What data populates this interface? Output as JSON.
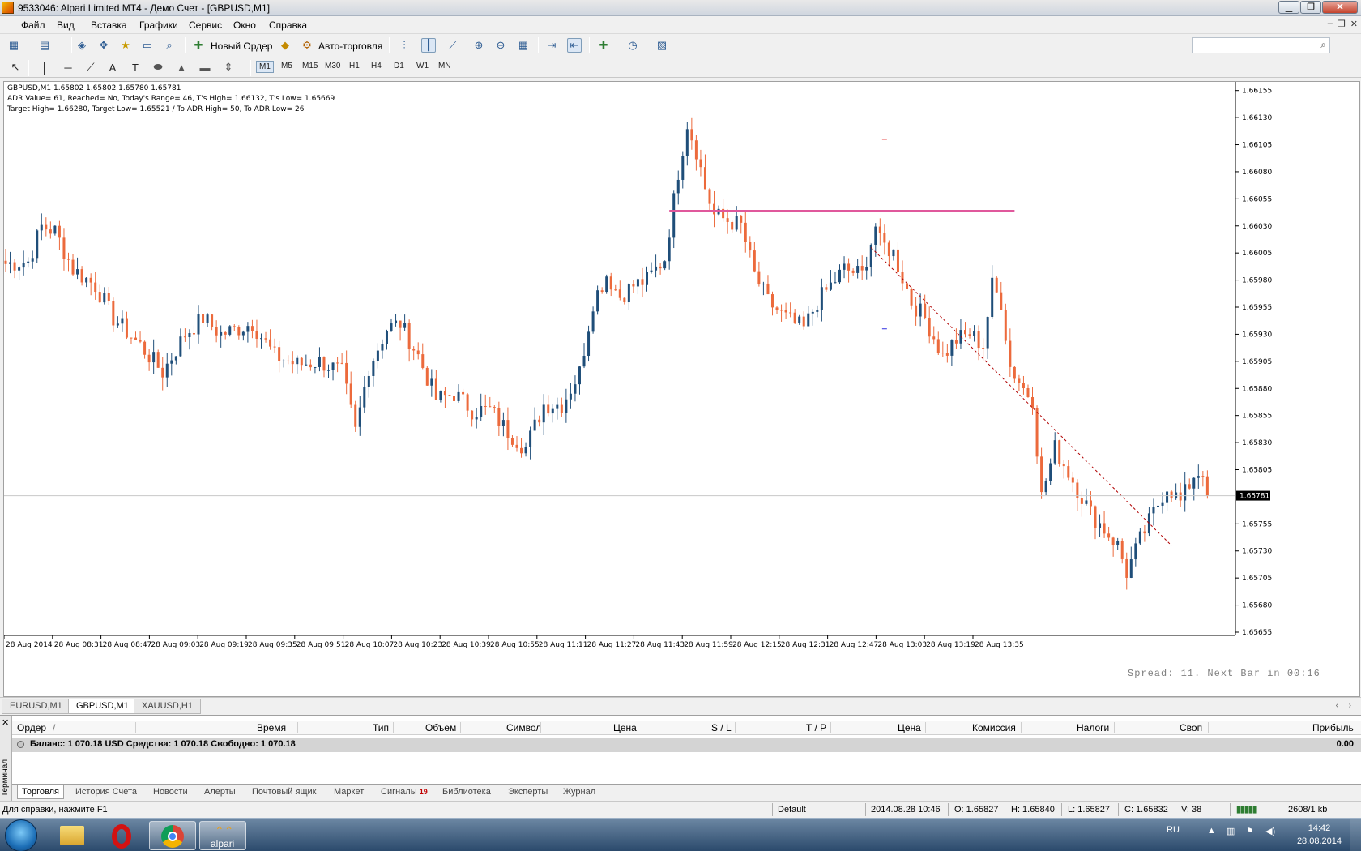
{
  "window": {
    "title": "9533046: Alpari Limited MT4 - Демо Счет - [GBPUSD,M1]"
  },
  "menu": [
    "Файл",
    "Вид",
    "Вставка",
    "Графики",
    "Сервис",
    "Окно",
    "Справка"
  ],
  "toolbar": {
    "new_order": "Новый Ордер",
    "auto_trading": "Авто-торговля"
  },
  "timeframes": [
    "M1",
    "M5",
    "M15",
    "M30",
    "H1",
    "H4",
    "D1",
    "W1",
    "MN"
  ],
  "active_timeframe": "M1",
  "chart_info": {
    "line1": "GBPUSD,M1  1.65802 1.65802 1.65780 1.65781",
    "line2": "ADR Value= 61, Reached= No, Today's Range= 46, T's High= 1.66132, T's Low= 1.65669",
    "line3": "Target High= 1.66280, Target Low= 1.65521 / To ADR High= 50, To ADR Low= 26"
  },
  "spread_text": "Spread: 11. Next Bar in 00:16",
  "chart_data": {
    "type": "candlestick",
    "symbol": "GBPUSD",
    "timeframe": "M1",
    "current_price": 1.65781,
    "y_ticks": [
      "1.66155",
      "1.66130",
      "1.66105",
      "1.66080",
      "1.66055",
      "1.66030",
      "1.66005",
      "1.65980",
      "1.65955",
      "1.65930",
      "1.65905",
      "1.65880",
      "1.65855",
      "1.65830",
      "1.65805",
      "1.65781",
      "1.65755",
      "1.65730",
      "1.65705",
      "1.65680",
      "1.65655"
    ],
    "ylim": [
      1.65652,
      1.66163
    ],
    "x_ticks": [
      "28 Aug 2014",
      "28 Aug 08:31",
      "28 Aug 08:47",
      "28 Aug 09:03",
      "28 Aug 09:19",
      "28 Aug 09:35",
      "28 Aug 09:51",
      "28 Aug 10:07",
      "28 Aug 10:23",
      "28 Aug 10:39",
      "28 Aug 10:55",
      "28 Aug 11:11",
      "28 Aug 11:27",
      "28 Aug 11:43",
      "28 Aug 11:59",
      "28 Aug 12:15",
      "28 Aug 12:31",
      "28 Aug 12:47",
      "28 Aug 13:03",
      "28 Aug 13:19",
      "28 Aug 13:35"
    ],
    "candle_count": 205,
    "close_path": [
      [
        0,
        1.65995
      ],
      [
        5,
        1.65997
      ],
      [
        8,
        1.6603
      ],
      [
        11,
        1.66025
      ],
      [
        15,
        1.6599
      ],
      [
        20,
        1.65975
      ],
      [
        24,
        1.65945
      ],
      [
        30,
        1.6592
      ],
      [
        35,
        1.65895
      ],
      [
        40,
        1.6593
      ],
      [
        44,
        1.65945
      ],
      [
        48,
        1.6593
      ],
      [
        55,
        1.6594
      ],
      [
        60,
        1.6591
      ],
      [
        65,
        1.65902
      ],
      [
        70,
        1.65905
      ],
      [
        75,
        1.65895
      ],
      [
        78,
        1.6584
      ],
      [
        81,
        1.659
      ],
      [
        85,
        1.65935
      ],
      [
        88,
        1.6594
      ],
      [
        92,
        1.6591
      ],
      [
        96,
        1.6587
      ],
      [
        100,
        1.65875
      ],
      [
        104,
        1.6586
      ],
      [
        108,
        1.6586
      ],
      [
        112,
        1.6584
      ],
      [
        116,
        1.65825
      ],
      [
        120,
        1.65865
      ],
      [
        124,
        1.65865
      ],
      [
        128,
        1.65895
      ],
      [
        131,
        1.6596
      ],
      [
        134,
        1.65985
      ],
      [
        137,
        1.65965
      ],
      [
        140,
        1.65975
      ],
      [
        143,
        1.6598
      ],
      [
        147,
        1.66
      ],
      [
        150,
        1.6608
      ],
      [
        152,
        1.66125
      ],
      [
        154,
        1.661
      ],
      [
        156,
        1.66065
      ],
      [
        158,
        1.6604
      ],
      [
        161,
        1.66035
      ],
      [
        164,
        1.6603
      ],
      [
        167,
        1.65985
      ],
      [
        170,
        1.6596
      ],
      [
        174,
        1.65945
      ],
      [
        178,
        1.65935
      ],
      [
        181,
        1.6596
      ],
      [
        184,
        1.65975
      ],
      [
        187,
        1.6599
      ],
      [
        191,
        1.65985
      ],
      [
        194,
        1.6603
      ],
      [
        195,
        1.66015
      ],
      [
        198,
        1.66005
      ],
      [
        202,
        1.6596
      ],
      [
        205,
        1.65945
      ],
      [
        209,
        1.6591
      ],
      [
        212,
        1.65925
      ],
      [
        215,
        1.6593
      ],
      [
        218,
        1.6592
      ],
      [
        220,
        1.65975
      ],
      [
        222,
        1.6596
      ],
      [
        224,
        1.659
      ],
      [
        227,
        1.6588
      ],
      [
        229,
        1.6587
      ],
      [
        231,
        1.6578
      ],
      [
        234,
        1.65825
      ],
      [
        238,
        1.65795
      ],
      [
        242,
        1.65765
      ],
      [
        245,
        1.6575
      ],
      [
        248,
        1.65735
      ],
      [
        250,
        1.6571
      ],
      [
        253,
        1.6574
      ],
      [
        256,
        1.65765
      ],
      [
        259,
        1.6579
      ],
      [
        262,
        1.65775
      ],
      [
        265,
        1.658
      ],
      [
        267,
        1.65805
      ],
      [
        268,
        1.65781
      ]
    ],
    "resistance_line": {
      "price": 1.66044,
      "from_index": 148,
      "to_index": 225
    },
    "trendline": {
      "from": [
        193,
        1.6601
      ],
      "to": [
        260,
        1.65735
      ]
    },
    "markers": [
      {
        "index": 196,
        "price": 1.6611,
        "color": "#e00000"
      },
      {
        "index": 196,
        "price": 1.65935,
        "color": "#3030e0"
      }
    ],
    "up_color": "#1f4e79",
    "down_color": "#ec6a3c",
    "grid": false
  },
  "chart_tabs": [
    "EURUSD,M1",
    "GBPUSD,M1",
    "XAUUSD,H1"
  ],
  "active_chart_tab": "GBPUSD,M1",
  "terminal": {
    "side_label": "Терминал",
    "columns": [
      "Ордер",
      "Время",
      "Тип",
      "Объем",
      "Символ",
      "Цена",
      "S / L",
      "T / P",
      "Цена",
      "Комиссия",
      "Налоги",
      "Своп",
      "Прибыль"
    ],
    "sort_marker": "/",
    "balance_line": "Баланс: 1 070.18 USD  Средства: 1 070.18  Свободно: 1 070.18",
    "profit": "0.00",
    "tabs": [
      "Торговля",
      "История Счета",
      "Новости",
      "Алерты",
      "Почтовый ящик",
      "Маркет",
      "Сигналы",
      "Библиотека",
      "Эксперты",
      "Журнал"
    ],
    "signals_badge": "19",
    "active_tab": "Торговля"
  },
  "status": {
    "help": "Для справки, нажмите F1",
    "profile": "Default",
    "datetime": "2014.08.28 10:46",
    "open": "O: 1.65827",
    "high": "H: 1.65840",
    "low": "L: 1.65827",
    "close": "C: 1.65832",
    "volume": "V: 38",
    "traffic": "2608/1 kb"
  },
  "taskbar": {
    "apps": [
      "explorer",
      "opera",
      "chrome",
      "alpari"
    ],
    "alpari_label": "alpari",
    "lang": "RU",
    "time": "14:42",
    "date": "28.08.2014"
  }
}
